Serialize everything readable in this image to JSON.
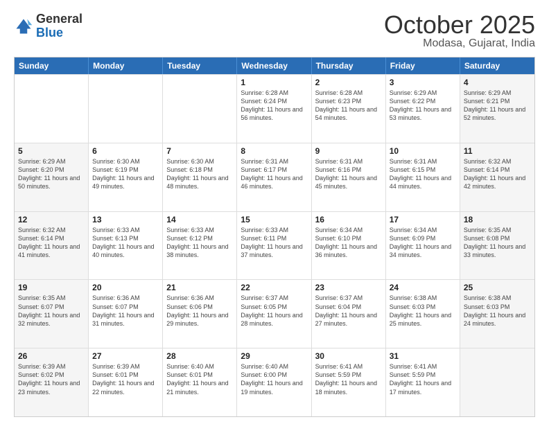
{
  "header": {
    "logo": {
      "line1": "General",
      "line2": "Blue"
    },
    "title": "October 2025",
    "location": "Modasa, Gujarat, India"
  },
  "weekdays": [
    "Sunday",
    "Monday",
    "Tuesday",
    "Wednesday",
    "Thursday",
    "Friday",
    "Saturday"
  ],
  "weeks": [
    [
      {
        "day": "",
        "detail": "",
        "shaded": false
      },
      {
        "day": "",
        "detail": "",
        "shaded": false
      },
      {
        "day": "",
        "detail": "",
        "shaded": false
      },
      {
        "day": "1",
        "detail": "Sunrise: 6:28 AM\nSunset: 6:24 PM\nDaylight: 11 hours and 56 minutes.",
        "shaded": false
      },
      {
        "day": "2",
        "detail": "Sunrise: 6:28 AM\nSunset: 6:23 PM\nDaylight: 11 hours and 54 minutes.",
        "shaded": false
      },
      {
        "day": "3",
        "detail": "Sunrise: 6:29 AM\nSunset: 6:22 PM\nDaylight: 11 hours and 53 minutes.",
        "shaded": false
      },
      {
        "day": "4",
        "detail": "Sunrise: 6:29 AM\nSunset: 6:21 PM\nDaylight: 11 hours and 52 minutes.",
        "shaded": true
      }
    ],
    [
      {
        "day": "5",
        "detail": "Sunrise: 6:29 AM\nSunset: 6:20 PM\nDaylight: 11 hours and 50 minutes.",
        "shaded": true
      },
      {
        "day": "6",
        "detail": "Sunrise: 6:30 AM\nSunset: 6:19 PM\nDaylight: 11 hours and 49 minutes.",
        "shaded": false
      },
      {
        "day": "7",
        "detail": "Sunrise: 6:30 AM\nSunset: 6:18 PM\nDaylight: 11 hours and 48 minutes.",
        "shaded": false
      },
      {
        "day": "8",
        "detail": "Sunrise: 6:31 AM\nSunset: 6:17 PM\nDaylight: 11 hours and 46 minutes.",
        "shaded": false
      },
      {
        "day": "9",
        "detail": "Sunrise: 6:31 AM\nSunset: 6:16 PM\nDaylight: 11 hours and 45 minutes.",
        "shaded": false
      },
      {
        "day": "10",
        "detail": "Sunrise: 6:31 AM\nSunset: 6:15 PM\nDaylight: 11 hours and 44 minutes.",
        "shaded": false
      },
      {
        "day": "11",
        "detail": "Sunrise: 6:32 AM\nSunset: 6:14 PM\nDaylight: 11 hours and 42 minutes.",
        "shaded": true
      }
    ],
    [
      {
        "day": "12",
        "detail": "Sunrise: 6:32 AM\nSunset: 6:14 PM\nDaylight: 11 hours and 41 minutes.",
        "shaded": true
      },
      {
        "day": "13",
        "detail": "Sunrise: 6:33 AM\nSunset: 6:13 PM\nDaylight: 11 hours and 40 minutes.",
        "shaded": false
      },
      {
        "day": "14",
        "detail": "Sunrise: 6:33 AM\nSunset: 6:12 PM\nDaylight: 11 hours and 38 minutes.",
        "shaded": false
      },
      {
        "day": "15",
        "detail": "Sunrise: 6:33 AM\nSunset: 6:11 PM\nDaylight: 11 hours and 37 minutes.",
        "shaded": false
      },
      {
        "day": "16",
        "detail": "Sunrise: 6:34 AM\nSunset: 6:10 PM\nDaylight: 11 hours and 36 minutes.",
        "shaded": false
      },
      {
        "day": "17",
        "detail": "Sunrise: 6:34 AM\nSunset: 6:09 PM\nDaylight: 11 hours and 34 minutes.",
        "shaded": false
      },
      {
        "day": "18",
        "detail": "Sunrise: 6:35 AM\nSunset: 6:08 PM\nDaylight: 11 hours and 33 minutes.",
        "shaded": true
      }
    ],
    [
      {
        "day": "19",
        "detail": "Sunrise: 6:35 AM\nSunset: 6:07 PM\nDaylight: 11 hours and 32 minutes.",
        "shaded": true
      },
      {
        "day": "20",
        "detail": "Sunrise: 6:36 AM\nSunset: 6:07 PM\nDaylight: 11 hours and 31 minutes.",
        "shaded": false
      },
      {
        "day": "21",
        "detail": "Sunrise: 6:36 AM\nSunset: 6:06 PM\nDaylight: 11 hours and 29 minutes.",
        "shaded": false
      },
      {
        "day": "22",
        "detail": "Sunrise: 6:37 AM\nSunset: 6:05 PM\nDaylight: 11 hours and 28 minutes.",
        "shaded": false
      },
      {
        "day": "23",
        "detail": "Sunrise: 6:37 AM\nSunset: 6:04 PM\nDaylight: 11 hours and 27 minutes.",
        "shaded": false
      },
      {
        "day": "24",
        "detail": "Sunrise: 6:38 AM\nSunset: 6:03 PM\nDaylight: 11 hours and 25 minutes.",
        "shaded": false
      },
      {
        "day": "25",
        "detail": "Sunrise: 6:38 AM\nSunset: 6:03 PM\nDaylight: 11 hours and 24 minutes.",
        "shaded": true
      }
    ],
    [
      {
        "day": "26",
        "detail": "Sunrise: 6:39 AM\nSunset: 6:02 PM\nDaylight: 11 hours and 23 minutes.",
        "shaded": true
      },
      {
        "day": "27",
        "detail": "Sunrise: 6:39 AM\nSunset: 6:01 PM\nDaylight: 11 hours and 22 minutes.",
        "shaded": false
      },
      {
        "day": "28",
        "detail": "Sunrise: 6:40 AM\nSunset: 6:01 PM\nDaylight: 11 hours and 21 minutes.",
        "shaded": false
      },
      {
        "day": "29",
        "detail": "Sunrise: 6:40 AM\nSunset: 6:00 PM\nDaylight: 11 hours and 19 minutes.",
        "shaded": false
      },
      {
        "day": "30",
        "detail": "Sunrise: 6:41 AM\nSunset: 5:59 PM\nDaylight: 11 hours and 18 minutes.",
        "shaded": false
      },
      {
        "day": "31",
        "detail": "Sunrise: 6:41 AM\nSunset: 5:59 PM\nDaylight: 11 hours and 17 minutes.",
        "shaded": false
      },
      {
        "day": "",
        "detail": "",
        "shaded": true
      }
    ]
  ]
}
